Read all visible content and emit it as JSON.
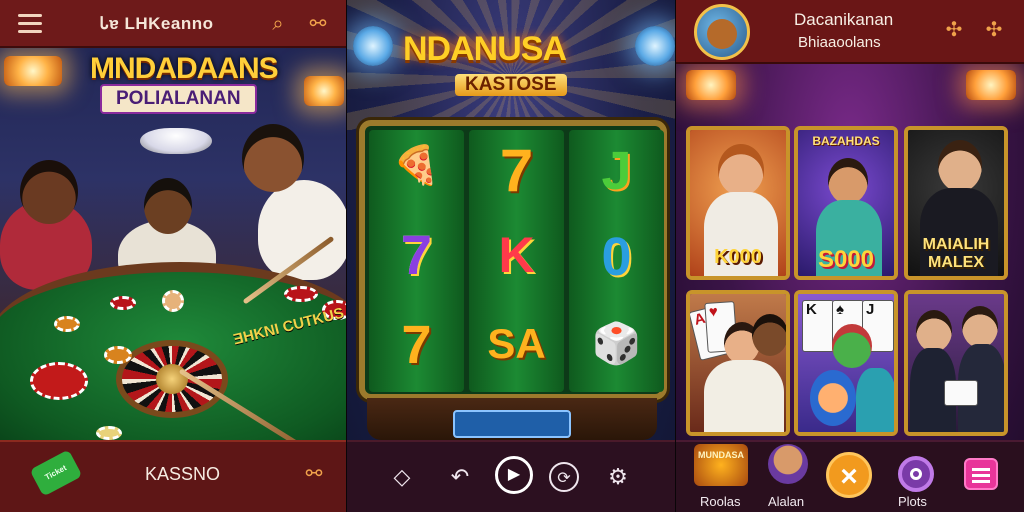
{
  "left": {
    "topbar": {
      "brand": "Ꮣɐ LHKeanno",
      "menu_icon": "hamburger-icon",
      "search_icon": "search-icon",
      "share_icon": "share-icon"
    },
    "logo": {
      "line1": "MNDADAANS",
      "line2": "POLIALANAN"
    },
    "table_text": "ƎHKNI CUTKUS",
    "bottombar": {
      "ticket_label": "Ticket",
      "label": "KASSNO",
      "share_icon": "share-icon"
    }
  },
  "middle": {
    "logo": {
      "line1": "NDANUSA",
      "line2": "KASTOSE"
    },
    "reels": [
      [
        "🍕",
        "7",
        "7"
      ],
      [
        "7",
        "K",
        "SA"
      ],
      [
        "J",
        "0",
        "🎲"
      ]
    ],
    "bottombar": {
      "icons": [
        "diamond-icon",
        "undo-icon",
        "play-icon",
        "refresh-icon",
        "settings-icon"
      ]
    }
  },
  "right": {
    "header": {
      "title": "Dacanikanan",
      "subtitle": "Bhiaaoolans"
    },
    "cards": [
      {
        "amount": "K000",
        "color": "#ffd43a"
      },
      {
        "title": "BAZAHDAS",
        "amount": "S000",
        "color": "#ffd43a"
      },
      {
        "amount": "MAIALIH MALEX",
        "color": "#ffe27a"
      }
    ],
    "bottombar": {
      "items": [
        {
          "label": "Roolas",
          "badge": "MUNDASA"
        },
        {
          "label": "Alalan"
        },
        {
          "label": ""
        },
        {
          "label": "Plots"
        },
        {
          "label": ""
        }
      ]
    },
    "colors": {
      "accent": "#f29a1e",
      "header": "#6a1616"
    }
  }
}
